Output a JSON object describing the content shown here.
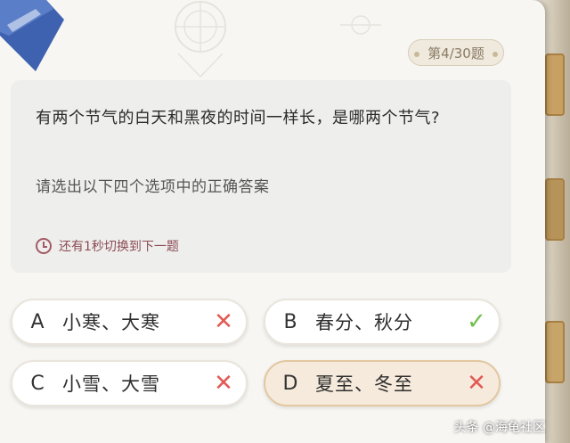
{
  "header": {
    "counter": "第4/30题"
  },
  "question": {
    "text": "有两个节气的白天和黑夜的时间一样长，是哪两个节气?",
    "prompt": "请选出以下四个选项中的正确答案",
    "timer_text": "还有1秒切换到下一题"
  },
  "options": [
    {
      "letter": "A",
      "text": "小寒、大寒",
      "result": "wrong",
      "mark": "✕"
    },
    {
      "letter": "B",
      "text": "春分、秋分",
      "result": "correct",
      "mark": "✓"
    },
    {
      "letter": "C",
      "text": "小雪、大雪",
      "result": "wrong",
      "mark": "✕"
    },
    {
      "letter": "D",
      "text": "夏至、冬至",
      "result": "wrong",
      "mark": "✕",
      "selected": true
    }
  ],
  "watermark": "头条 @海龟社区",
  "colors": {
    "wrong": "#e35a55",
    "correct": "#6fbf4c",
    "accent": "#3f62b0"
  }
}
